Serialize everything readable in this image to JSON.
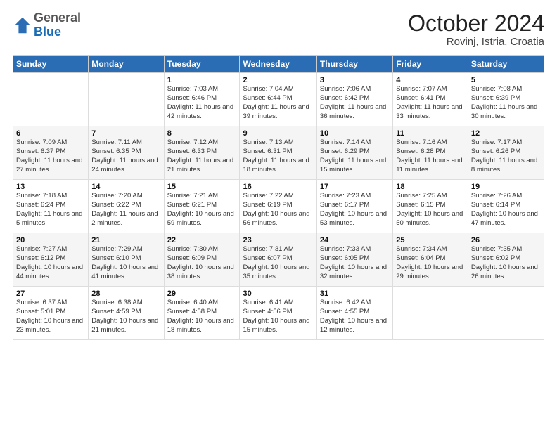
{
  "header": {
    "logo_general": "General",
    "logo_blue": "Blue",
    "month_year": "October 2024",
    "location": "Rovinj, Istria, Croatia"
  },
  "calendar": {
    "days_of_week": [
      "Sunday",
      "Monday",
      "Tuesday",
      "Wednesday",
      "Thursday",
      "Friday",
      "Saturday"
    ],
    "weeks": [
      [
        {
          "day": "",
          "sunrise": "",
          "sunset": "",
          "daylight": ""
        },
        {
          "day": "",
          "sunrise": "",
          "sunset": "",
          "daylight": ""
        },
        {
          "day": "1",
          "sunrise": "Sunrise: 7:03 AM",
          "sunset": "Sunset: 6:46 PM",
          "daylight": "Daylight: 11 hours and 42 minutes."
        },
        {
          "day": "2",
          "sunrise": "Sunrise: 7:04 AM",
          "sunset": "Sunset: 6:44 PM",
          "daylight": "Daylight: 11 hours and 39 minutes."
        },
        {
          "day": "3",
          "sunrise": "Sunrise: 7:06 AM",
          "sunset": "Sunset: 6:42 PM",
          "daylight": "Daylight: 11 hours and 36 minutes."
        },
        {
          "day": "4",
          "sunrise": "Sunrise: 7:07 AM",
          "sunset": "Sunset: 6:41 PM",
          "daylight": "Daylight: 11 hours and 33 minutes."
        },
        {
          "day": "5",
          "sunrise": "Sunrise: 7:08 AM",
          "sunset": "Sunset: 6:39 PM",
          "daylight": "Daylight: 11 hours and 30 minutes."
        }
      ],
      [
        {
          "day": "6",
          "sunrise": "Sunrise: 7:09 AM",
          "sunset": "Sunset: 6:37 PM",
          "daylight": "Daylight: 11 hours and 27 minutes."
        },
        {
          "day": "7",
          "sunrise": "Sunrise: 7:11 AM",
          "sunset": "Sunset: 6:35 PM",
          "daylight": "Daylight: 11 hours and 24 minutes."
        },
        {
          "day": "8",
          "sunrise": "Sunrise: 7:12 AM",
          "sunset": "Sunset: 6:33 PM",
          "daylight": "Daylight: 11 hours and 21 minutes."
        },
        {
          "day": "9",
          "sunrise": "Sunrise: 7:13 AM",
          "sunset": "Sunset: 6:31 PM",
          "daylight": "Daylight: 11 hours and 18 minutes."
        },
        {
          "day": "10",
          "sunrise": "Sunrise: 7:14 AM",
          "sunset": "Sunset: 6:29 PM",
          "daylight": "Daylight: 11 hours and 15 minutes."
        },
        {
          "day": "11",
          "sunrise": "Sunrise: 7:16 AM",
          "sunset": "Sunset: 6:28 PM",
          "daylight": "Daylight: 11 hours and 11 minutes."
        },
        {
          "day": "12",
          "sunrise": "Sunrise: 7:17 AM",
          "sunset": "Sunset: 6:26 PM",
          "daylight": "Daylight: 11 hours and 8 minutes."
        }
      ],
      [
        {
          "day": "13",
          "sunrise": "Sunrise: 7:18 AM",
          "sunset": "Sunset: 6:24 PM",
          "daylight": "Daylight: 11 hours and 5 minutes."
        },
        {
          "day": "14",
          "sunrise": "Sunrise: 7:20 AM",
          "sunset": "Sunset: 6:22 PM",
          "daylight": "Daylight: 11 hours and 2 minutes."
        },
        {
          "day": "15",
          "sunrise": "Sunrise: 7:21 AM",
          "sunset": "Sunset: 6:21 PM",
          "daylight": "Daylight: 10 hours and 59 minutes."
        },
        {
          "day": "16",
          "sunrise": "Sunrise: 7:22 AM",
          "sunset": "Sunset: 6:19 PM",
          "daylight": "Daylight: 10 hours and 56 minutes."
        },
        {
          "day": "17",
          "sunrise": "Sunrise: 7:23 AM",
          "sunset": "Sunset: 6:17 PM",
          "daylight": "Daylight: 10 hours and 53 minutes."
        },
        {
          "day": "18",
          "sunrise": "Sunrise: 7:25 AM",
          "sunset": "Sunset: 6:15 PM",
          "daylight": "Daylight: 10 hours and 50 minutes."
        },
        {
          "day": "19",
          "sunrise": "Sunrise: 7:26 AM",
          "sunset": "Sunset: 6:14 PM",
          "daylight": "Daylight: 10 hours and 47 minutes."
        }
      ],
      [
        {
          "day": "20",
          "sunrise": "Sunrise: 7:27 AM",
          "sunset": "Sunset: 6:12 PM",
          "daylight": "Daylight: 10 hours and 44 minutes."
        },
        {
          "day": "21",
          "sunrise": "Sunrise: 7:29 AM",
          "sunset": "Sunset: 6:10 PM",
          "daylight": "Daylight: 10 hours and 41 minutes."
        },
        {
          "day": "22",
          "sunrise": "Sunrise: 7:30 AM",
          "sunset": "Sunset: 6:09 PM",
          "daylight": "Daylight: 10 hours and 38 minutes."
        },
        {
          "day": "23",
          "sunrise": "Sunrise: 7:31 AM",
          "sunset": "Sunset: 6:07 PM",
          "daylight": "Daylight: 10 hours and 35 minutes."
        },
        {
          "day": "24",
          "sunrise": "Sunrise: 7:33 AM",
          "sunset": "Sunset: 6:05 PM",
          "daylight": "Daylight: 10 hours and 32 minutes."
        },
        {
          "day": "25",
          "sunrise": "Sunrise: 7:34 AM",
          "sunset": "Sunset: 6:04 PM",
          "daylight": "Daylight: 10 hours and 29 minutes."
        },
        {
          "day": "26",
          "sunrise": "Sunrise: 7:35 AM",
          "sunset": "Sunset: 6:02 PM",
          "daylight": "Daylight: 10 hours and 26 minutes."
        }
      ],
      [
        {
          "day": "27",
          "sunrise": "Sunrise: 6:37 AM",
          "sunset": "Sunset: 5:01 PM",
          "daylight": "Daylight: 10 hours and 23 minutes."
        },
        {
          "day": "28",
          "sunrise": "Sunrise: 6:38 AM",
          "sunset": "Sunset: 4:59 PM",
          "daylight": "Daylight: 10 hours and 21 minutes."
        },
        {
          "day": "29",
          "sunrise": "Sunrise: 6:40 AM",
          "sunset": "Sunset: 4:58 PM",
          "daylight": "Daylight: 10 hours and 18 minutes."
        },
        {
          "day": "30",
          "sunrise": "Sunrise: 6:41 AM",
          "sunset": "Sunset: 4:56 PM",
          "daylight": "Daylight: 10 hours and 15 minutes."
        },
        {
          "day": "31",
          "sunrise": "Sunrise: 6:42 AM",
          "sunset": "Sunset: 4:55 PM",
          "daylight": "Daylight: 10 hours and 12 minutes."
        },
        {
          "day": "",
          "sunrise": "",
          "sunset": "",
          "daylight": ""
        },
        {
          "day": "",
          "sunrise": "",
          "sunset": "",
          "daylight": ""
        }
      ]
    ]
  }
}
